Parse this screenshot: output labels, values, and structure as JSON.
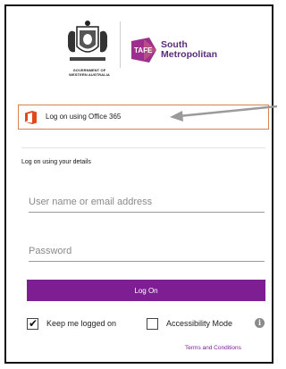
{
  "logos": {
    "government_text_line1": "GOVERNMENT OF",
    "government_text_line2": "WESTERN AUSTRALIA",
    "tafe_badge_text": "TAFE",
    "institution_line1": "South",
    "institution_line2": "Metropolitan"
  },
  "office365": {
    "label": "Log on using Office 365",
    "icon": "office-icon"
  },
  "details": {
    "section_title": "Log on using your details",
    "username_placeholder": "User name or email address",
    "password_placeholder": "Password",
    "logon_label": "Log On"
  },
  "options": {
    "keep_logged_label": "Keep me logged on",
    "keep_logged_checked": true,
    "accessibility_label": "Accessibility Mode",
    "accessibility_checked": false,
    "info_icon": "info-icon",
    "info_glyph": "i"
  },
  "footer": {
    "terms_label": "Terms and Conditions"
  },
  "colors": {
    "brand_purple": "#7d1f93",
    "office_orange": "#e2491a",
    "highlight_border": "#d7824b"
  }
}
